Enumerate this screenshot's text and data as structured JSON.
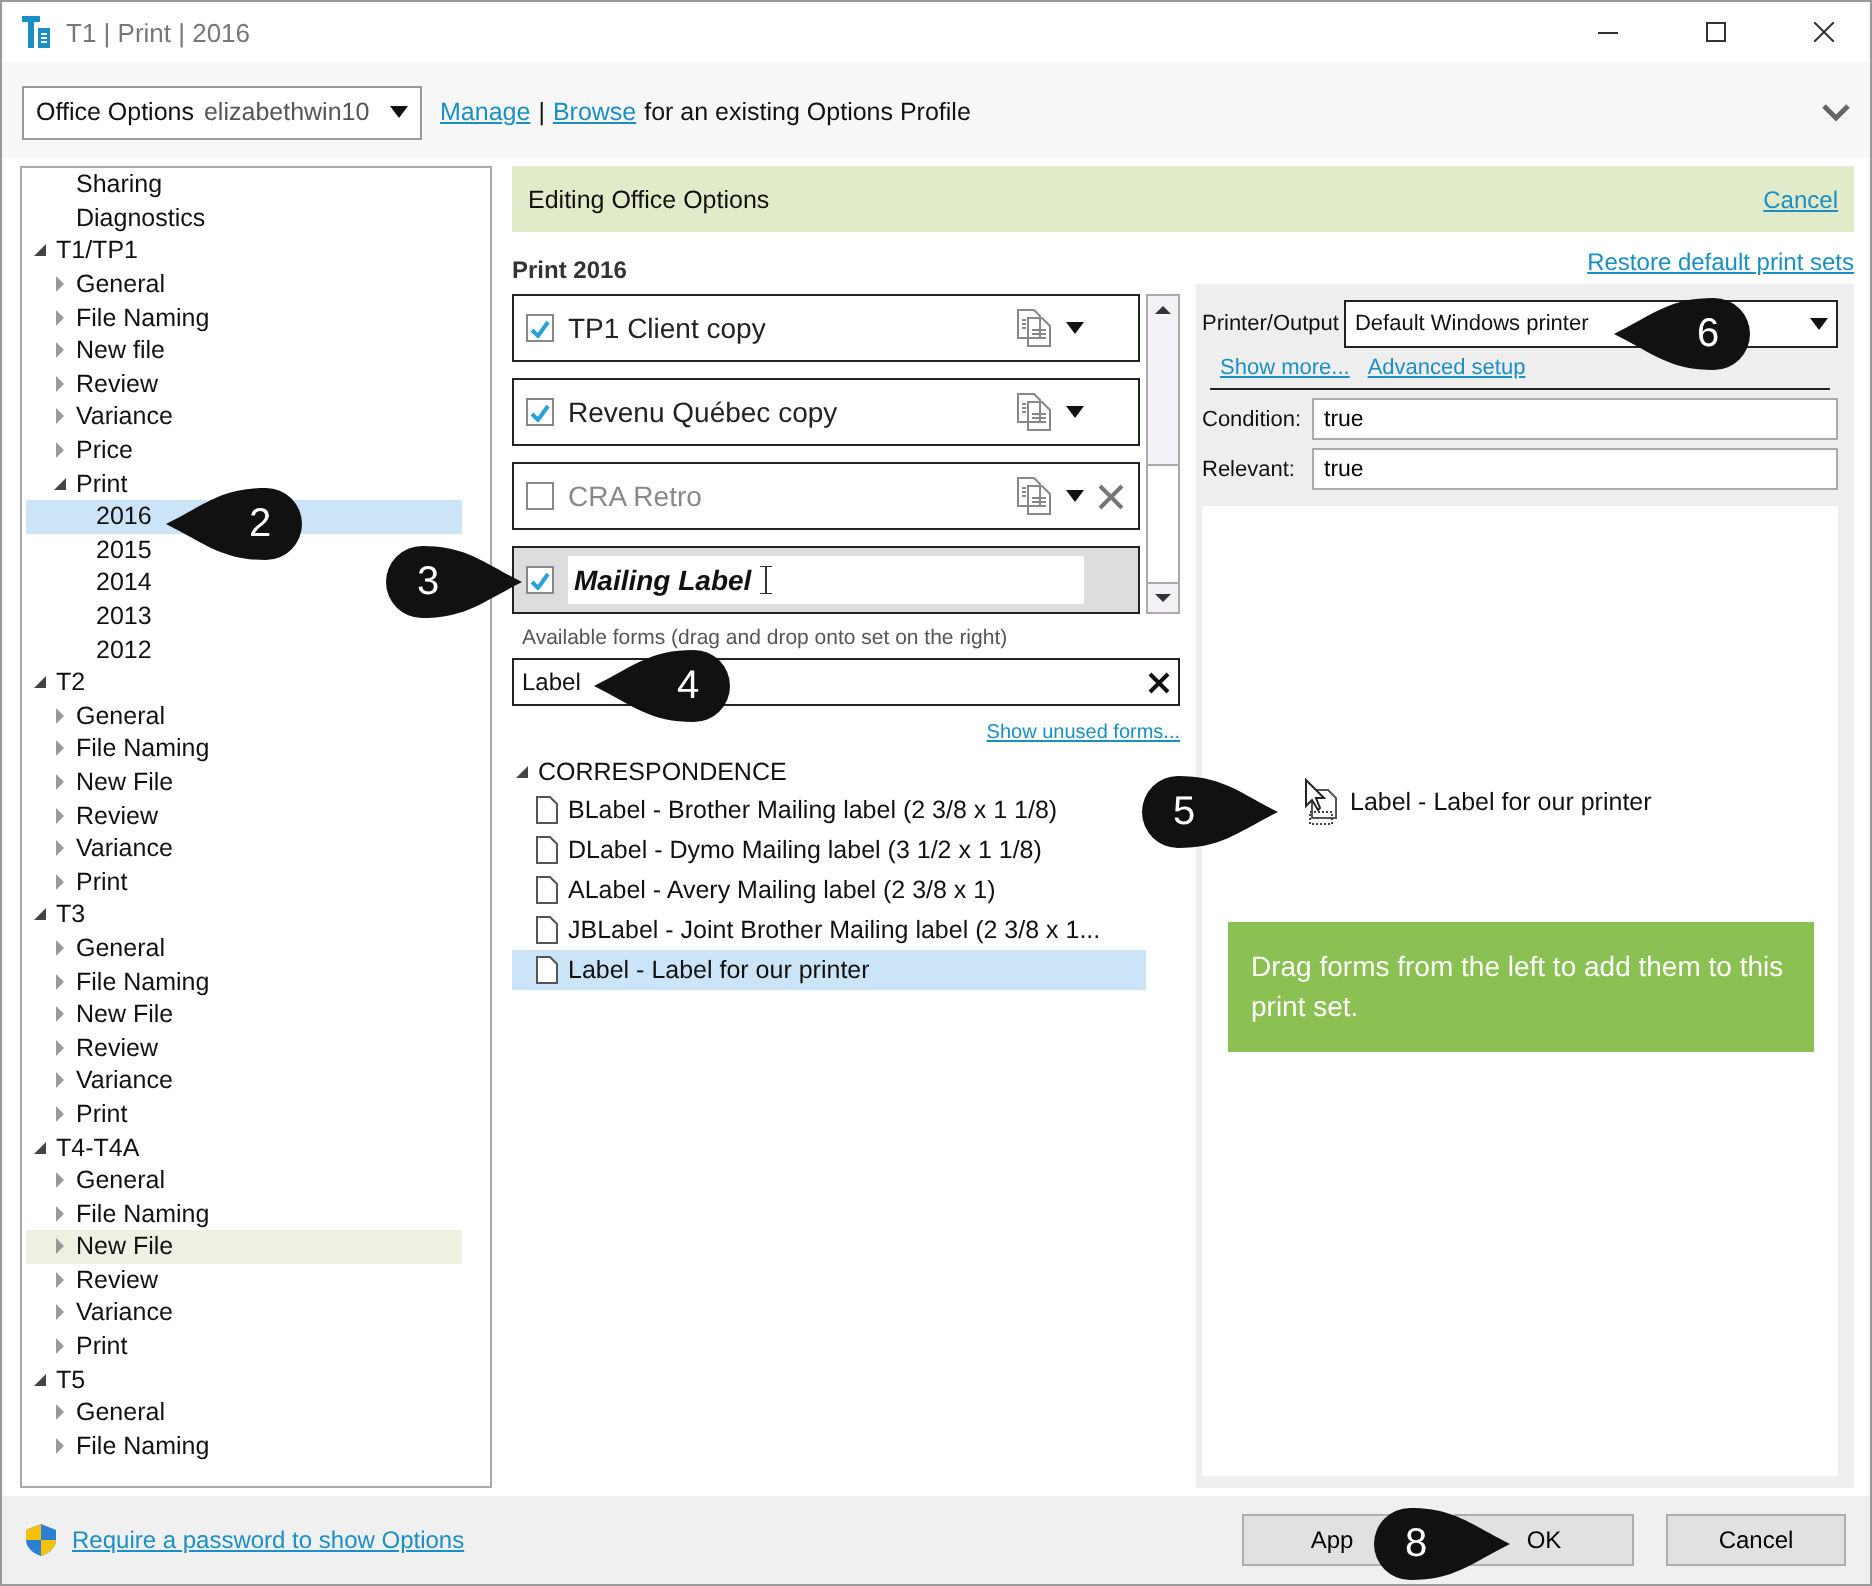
{
  "window": {
    "title": "T1 | Print | 2016"
  },
  "profile": {
    "label": "Office Options",
    "value": "elizabethwin10",
    "links": [
      "Manage",
      "Browse"
    ],
    "separator": "|",
    "hint": "for an existing Options Profile"
  },
  "sidebar": {
    "items": [
      {
        "label": "Sharing"
      },
      {
        "label": "Diagnostics"
      },
      {
        "label": "T1/TP1",
        "expanded": true,
        "children": [
          {
            "label": "General",
            "expanded": false
          },
          {
            "label": "File Naming",
            "expanded": false
          },
          {
            "label": "New file",
            "expanded": false
          },
          {
            "label": "Review",
            "expanded": false
          },
          {
            "label": "Variance",
            "expanded": false
          },
          {
            "label": "Price",
            "expanded": false
          },
          {
            "label": "Print",
            "expanded": true,
            "children": [
              {
                "label": "2016",
                "selected": true
              },
              {
                "label": "2015",
                "selected": false
              },
              {
                "label": "2014",
                "selected": false
              },
              {
                "label": "2013",
                "selected": false
              },
              {
                "label": "2012",
                "selected": false
              }
            ]
          }
        ]
      },
      {
        "label": "T2",
        "expanded": true,
        "children": [
          {
            "label": "General",
            "expanded": false
          },
          {
            "label": "File Naming",
            "expanded": false
          },
          {
            "label": "New File",
            "expanded": false
          },
          {
            "label": "Review",
            "expanded": false
          },
          {
            "label": "Variance",
            "expanded": false
          },
          {
            "label": "Print",
            "expanded": false
          }
        ]
      },
      {
        "label": "T3",
        "expanded": true,
        "children": [
          {
            "label": "General",
            "expanded": false
          },
          {
            "label": "File Naming",
            "expanded": false
          },
          {
            "label": "New File",
            "expanded": false
          },
          {
            "label": "Review",
            "expanded": false
          },
          {
            "label": "Variance",
            "expanded": false
          },
          {
            "label": "Print",
            "expanded": false
          }
        ]
      },
      {
        "label": "T4-T4A",
        "expanded": true,
        "children": [
          {
            "label": "General",
            "expanded": false
          },
          {
            "label": "File Naming",
            "expanded": false
          },
          {
            "label": "New File",
            "expanded": false,
            "hovered": true
          },
          {
            "label": "Review",
            "expanded": false
          },
          {
            "label": "Variance",
            "expanded": false
          },
          {
            "label": "Print",
            "expanded": false
          }
        ]
      },
      {
        "label": "T5",
        "expanded": true,
        "children": [
          {
            "label": "General",
            "expanded": false
          },
          {
            "label": "File Naming",
            "expanded": false
          }
        ]
      }
    ]
  },
  "editing_bar": {
    "title": "Editing Office Options",
    "cancel": "Cancel"
  },
  "print_sets": {
    "title": "Print 2016",
    "restore": "Restore default print sets",
    "items": [
      {
        "name": "TP1 Client copy",
        "checked": true,
        "editing": false,
        "removable": false
      },
      {
        "name": "Revenu Québec copy",
        "checked": true,
        "editing": false,
        "removable": false
      },
      {
        "name": "CRA Retro",
        "checked": false,
        "editing": false,
        "removable": true
      },
      {
        "name": "Mailing Label",
        "checked": true,
        "editing": true,
        "removable": false
      }
    ]
  },
  "forms": {
    "hint": "Available forms (drag and drop onto set on the right)",
    "search": {
      "value": "Label"
    },
    "show_unused": "Show unused forms...",
    "groups": [
      {
        "name": "CORRESPONDENCE",
        "expanded": true,
        "children": [
          {
            "label": "BLabel - Brother Mailing label (2 3/8 x 1 1/8)",
            "selected": false
          },
          {
            "label": "DLabel - Dymo Mailing label (3 1/2 x 1 1/8)",
            "selected": false
          },
          {
            "label": "ALabel - Avery Mailing label (2 3/8 x 1)",
            "selected": false
          },
          {
            "label": "JBLabel - Joint Brother Mailing label (2 3/8 x 1...",
            "selected": false
          },
          {
            "label": "Label - Label for our printer",
            "selected": true
          }
        ]
      }
    ]
  },
  "settings": {
    "printer_label": "Printer/Output",
    "printer_value": "Default Windows printer",
    "links": [
      "Show more...",
      "Advanced setup"
    ],
    "fields": [
      {
        "label": "Condition:",
        "value": "true"
      },
      {
        "label": "Relevant:",
        "value": "true"
      }
    ]
  },
  "drop_area": {
    "dragged_form": "Label - Label for our printer",
    "hint": "Drag forms from the left to add them to this print set."
  },
  "footer": {
    "password_link": "Require a password to show Options",
    "buttons": [
      "App",
      "OK",
      "Cancel"
    ]
  },
  "callouts": [
    "2",
    "3",
    "4",
    "5",
    "6",
    "8"
  ]
}
